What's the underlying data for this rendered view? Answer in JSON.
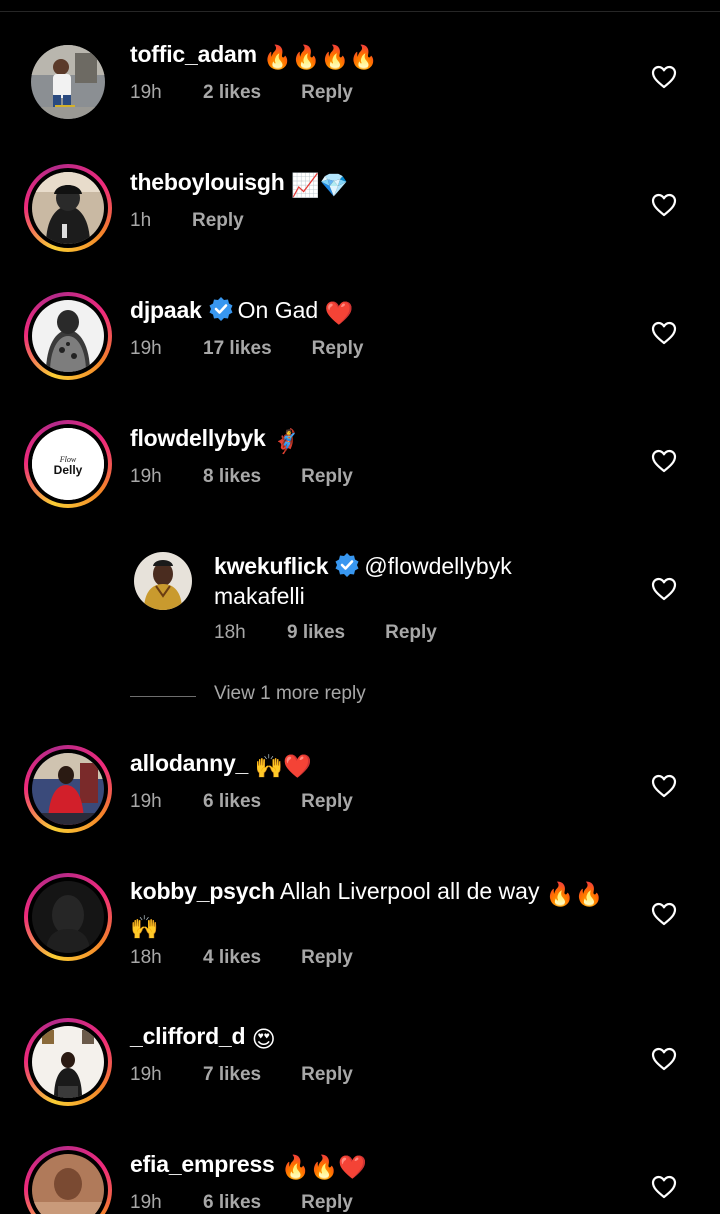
{
  "comments": [
    {
      "username": "toffic_adam",
      "text": "",
      "emojis": "🔥🔥🔥🔥",
      "time": "19h",
      "likes": "2 likes",
      "reply": "Reply",
      "verified": false
    },
    {
      "username": "theboylouisgh",
      "text": "",
      "emojis": "📈💎",
      "time": "1h",
      "likes": "",
      "reply": "Reply",
      "verified": false
    },
    {
      "username": "djpaak",
      "text": "On Gad",
      "emojis": "❤️",
      "time": "19h",
      "likes": "17 likes",
      "reply": "Reply",
      "verified": true
    },
    {
      "username": "flowdellybyk",
      "text": "",
      "emojis": "🦸",
      "time": "19h",
      "likes": "8 likes",
      "reply": "Reply",
      "verified": false,
      "avatar_text": "Flow Delly"
    },
    {
      "username": "kwekuflick",
      "mention": "@flowdellybyk",
      "text": "makafelli",
      "time": "18h",
      "likes": "9 likes",
      "reply": "Reply",
      "verified": true
    },
    {
      "username": "allodanny_",
      "text": "",
      "emojis": "🙌❤️",
      "time": "19h",
      "likes": "6 likes",
      "reply": "Reply",
      "verified": false
    },
    {
      "username": "kobby_psych",
      "text": "Allah Liverpool all de way",
      "emojis": "🔥🔥",
      "emojis2": "🙌",
      "time": "18h",
      "likes": "4 likes",
      "reply": "Reply",
      "verified": false
    },
    {
      "username": "_clifford_d",
      "text": "",
      "emojis": "😍",
      "time": "19h",
      "likes": "7 likes",
      "reply": "Reply",
      "verified": false
    },
    {
      "username": "efia_empress",
      "text": "",
      "emojis": "🔥🔥❤️",
      "time": "19h",
      "likes": "6 likes",
      "reply": "Reply",
      "verified": false
    }
  ],
  "view_more": "View 1 more reply",
  "colors": {
    "background": "#000000",
    "text": "#ffffff",
    "meta": "#a8a8a8",
    "verified": "#3897f0",
    "divider": "#262626"
  },
  "icons": {
    "like": "heart-outline-icon",
    "verified": "verified-badge-icon"
  }
}
